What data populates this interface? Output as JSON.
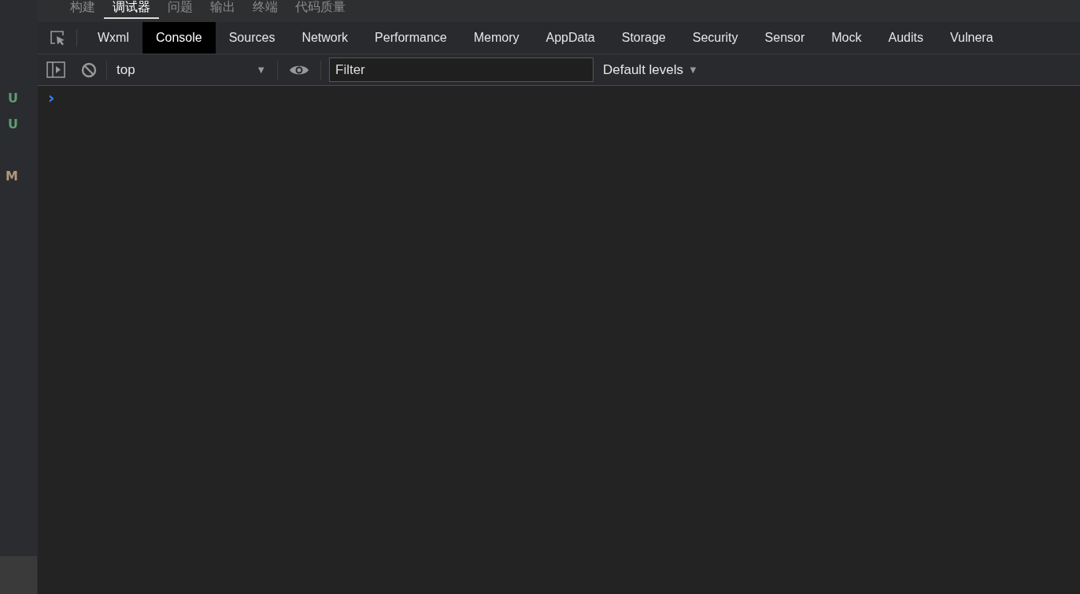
{
  "gutter": {
    "items": [
      {
        "status": "U",
        "color": "#5f9e72"
      },
      {
        "status": "U",
        "color": "#5f9e72"
      },
      {
        "status": "M",
        "color": "#b3977a"
      }
    ]
  },
  "panel_tabs": [
    {
      "label": "构建",
      "selected": false
    },
    {
      "label": "调试器",
      "selected": true
    },
    {
      "label": "问题",
      "selected": false
    },
    {
      "label": "输出",
      "selected": false
    },
    {
      "label": "终端",
      "selected": false
    },
    {
      "label": "代码质量",
      "selected": false
    }
  ],
  "devtools_tabs": [
    {
      "label": "Wxml",
      "selected": false
    },
    {
      "label": "Console",
      "selected": true
    },
    {
      "label": "Sources",
      "selected": false
    },
    {
      "label": "Network",
      "selected": false
    },
    {
      "label": "Performance",
      "selected": false
    },
    {
      "label": "Memory",
      "selected": false
    },
    {
      "label": "AppData",
      "selected": false
    },
    {
      "label": "Storage",
      "selected": false
    },
    {
      "label": "Security",
      "selected": false
    },
    {
      "label": "Sensor",
      "selected": false
    },
    {
      "label": "Mock",
      "selected": false
    },
    {
      "label": "Audits",
      "selected": false
    },
    {
      "label": "Vulnera",
      "selected": false
    }
  ],
  "toolbar": {
    "context": "top",
    "filter": {
      "placeholder": "Filter"
    },
    "levels": "Default levels",
    "levels_caret": "▼",
    "context_caret": "▼"
  },
  "console": {
    "prompt": "›"
  }
}
